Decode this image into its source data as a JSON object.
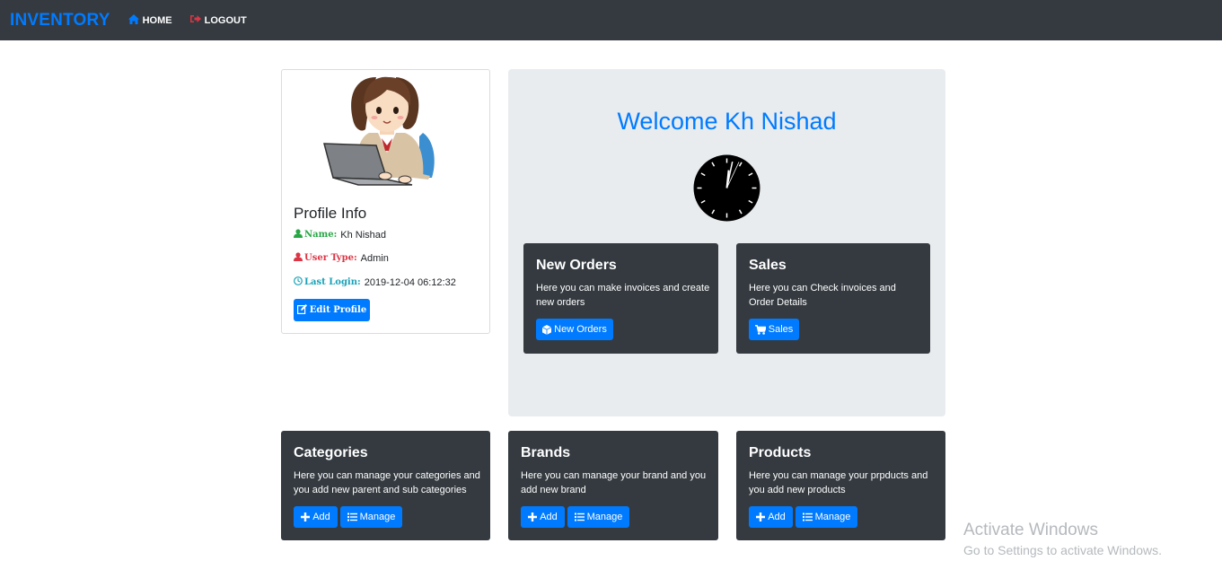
{
  "navbar": {
    "brand": "INVENTORY",
    "home_label": "HOME",
    "logout_label": "LOGOUT"
  },
  "profile": {
    "title": "Profile Info",
    "name_label": "Name:",
    "name_value": "Kh Nishad",
    "user_type_label": "User Type:",
    "user_type_value": "Admin",
    "last_login_label": "Last Login:",
    "last_login_value": "2019-12-04 06:12:32",
    "edit_button": "Edit Profile"
  },
  "welcome": {
    "text": "Welcome Kh Nishad"
  },
  "cards": {
    "new_orders": {
      "title": "New Orders",
      "text": "Here you can make invoices and create new orders",
      "button": "New Orders"
    },
    "sales": {
      "title": "Sales",
      "text": "Here you can Check invoices and Order Details",
      "button": "Sales"
    },
    "categories": {
      "title": "Categories",
      "text": "Here you can manage your categories and you add new parent and sub categories",
      "add": "Add",
      "manage": "Manage"
    },
    "brands": {
      "title": "Brands",
      "text": "Here you can manage your brand and you add new brand",
      "add": "Add",
      "manage": "Manage"
    },
    "products": {
      "title": "Products",
      "text": "Here you can manage your prpducts and you add new products",
      "add": "Add",
      "manage": "Manage"
    }
  },
  "watermark": {
    "title": "Activate Windows",
    "subtitle": "Go to Settings to activate Windows."
  },
  "colors": {
    "navbar_bg": "#343a40",
    "primary": "#007bff",
    "card_dark": "#343a40",
    "jumbotron_bg": "#e9ecef",
    "success": "#28a745",
    "danger": "#dc3545",
    "info": "#17a2b8"
  },
  "icons": {
    "home": "home-icon",
    "logout": "sign-out-icon",
    "user": "user-icon",
    "clock": "clock-icon",
    "edit": "edit-icon",
    "cube": "cube-icon",
    "cart": "shopping-cart-icon",
    "plus": "plus-icon",
    "list": "list-icon"
  }
}
